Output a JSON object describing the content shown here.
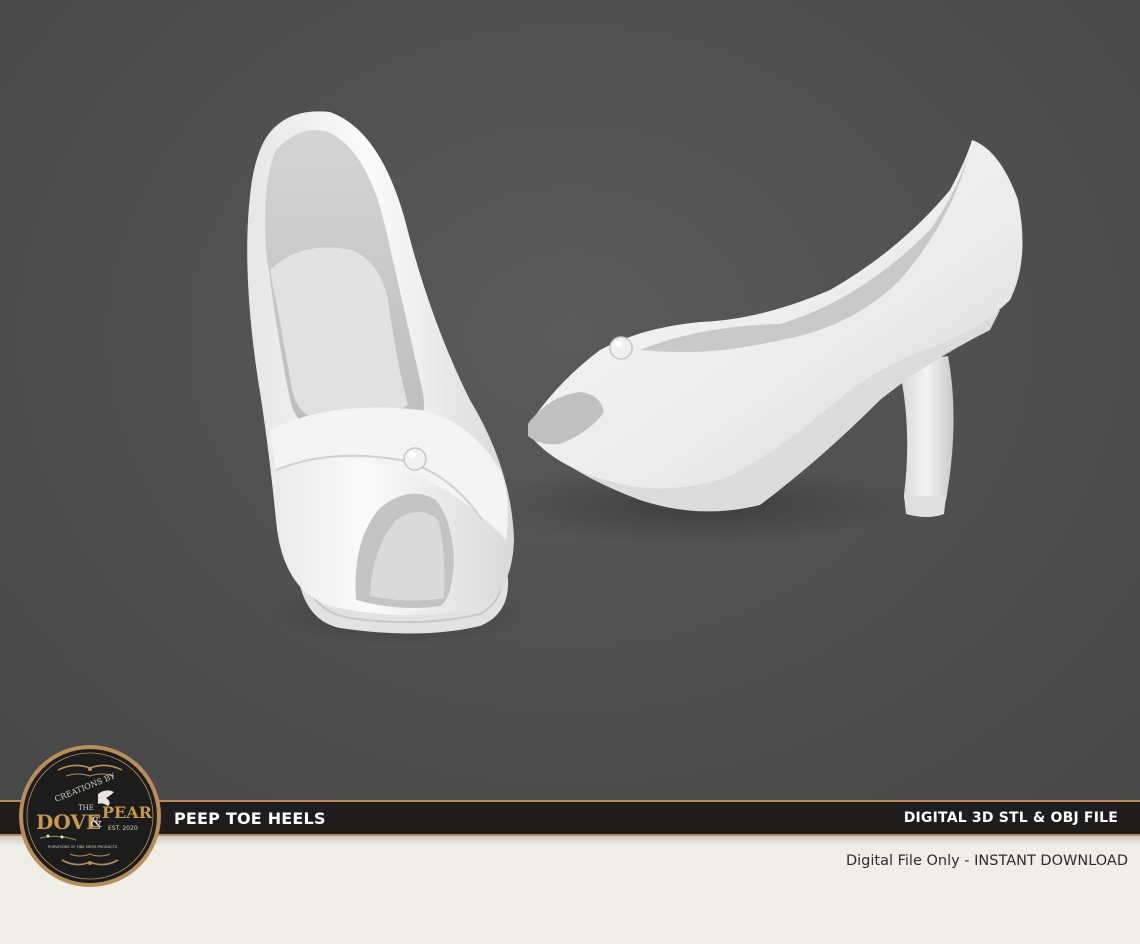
{
  "banner": {
    "product_name": "PEEP TOE HEELS",
    "file_type": "DIGITAL 3D STL & OBJ FILE"
  },
  "footer": {
    "download_note": "Digital File Only - INSTANT DOWNLOAD"
  },
  "logo": {
    "arc_text": "CREATIONS BY",
    "the": "THE",
    "dove": "DOVE",
    "amp": "&",
    "pear": "PEAR",
    "est": "EST. 2020",
    "tagline": "PURVEYORS OF FINE MESH PRODUCTS"
  },
  "colors": {
    "background_gray": "#525252",
    "banner_dark": "#1e1d1c",
    "gold_accent": "#b88d5c",
    "cream": "#f1eee8",
    "shoe_white": "#efefef"
  }
}
